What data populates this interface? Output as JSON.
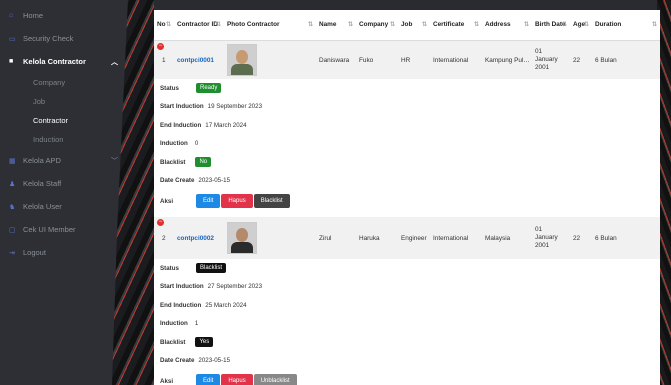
{
  "sidebar": {
    "items": [
      {
        "label": "Home",
        "icon": "home-icon"
      },
      {
        "label": "Security Check",
        "icon": "shield-icon"
      },
      {
        "label": "Kelola Contractor",
        "icon": "folder-icon"
      },
      {
        "label": "Kelola APD",
        "icon": "grid-icon"
      },
      {
        "label": "Kelola Staff",
        "icon": "user-icon"
      },
      {
        "label": "Kelola User",
        "icon": "users-icon"
      },
      {
        "label": "Cek UI Member",
        "icon": "monitor-icon"
      },
      {
        "label": "Logout",
        "icon": "logout-icon"
      }
    ],
    "sub_items": [
      "Company",
      "Job",
      "Contractor",
      "Induction"
    ]
  },
  "table": {
    "columns": [
      "No",
      "Contractor ID",
      "Photo Contractor",
      "Name",
      "Company",
      "Job",
      "Certificate",
      "Address",
      "Birth Date",
      "Age",
      "Duration"
    ],
    "rows": [
      {
        "no": "1",
        "id": "contpci0001",
        "name": "Daniswara",
        "company": "Fuko",
        "job": "HR",
        "certificate": "International",
        "address": "Kampung Pulu...",
        "birth1": "01",
        "birth2": "January",
        "birth3": "2001",
        "age": "22",
        "duration": "6 Bulan"
      },
      {
        "no": "2",
        "id": "contpci0002",
        "name": "Zirul",
        "company": "Haruka",
        "job": "Engineer",
        "certificate": "International",
        "address": "Malaysia",
        "birth1": "01",
        "birth2": "January",
        "birth3": "2001",
        "age": "22",
        "duration": "6 Bulan"
      }
    ]
  },
  "labels": {
    "status": "Status",
    "start_induction": "Start Induction",
    "end_induction": "End Induction",
    "induction": "Induction",
    "blacklist": "Blacklist",
    "date_create": "Date Create",
    "aksi": "Aksi"
  },
  "details": [
    {
      "status": "Ready",
      "start": "19 September 2023",
      "end": "17 March 2024",
      "induction": "0",
      "blacklist": "No",
      "date_create": "2023-05-15",
      "btn_edit": "Edit",
      "btn_hapus": "Hapus",
      "btn_blacklist": "Blacklist"
    },
    {
      "status": "Blacklist",
      "start": "27 September 2023",
      "end": "25 March 2024",
      "induction": "1",
      "blacklist": "Yes",
      "date_create": "2023-05-15",
      "btn_edit": "Edit",
      "btn_hapus": "Hapus",
      "btn_blacklist": "Unblacklist"
    }
  ],
  "colors": {
    "accent": "#1e88e5",
    "danger": "#e2334a",
    "success": "#1e8e2e"
  }
}
